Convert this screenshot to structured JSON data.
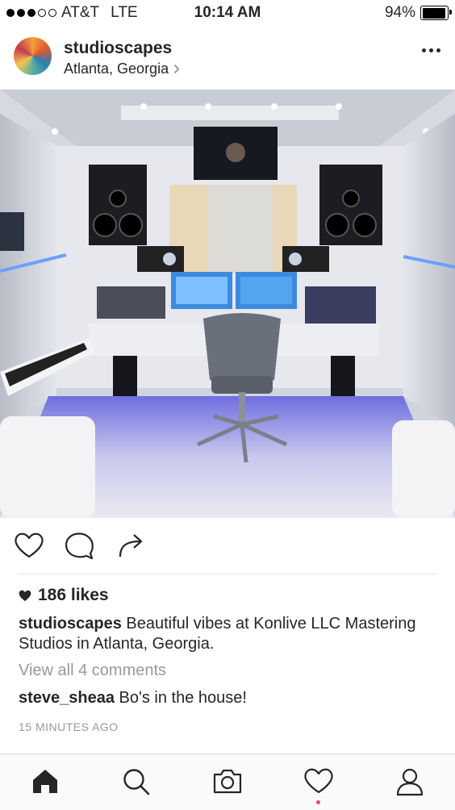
{
  "status_bar": {
    "carrier": "AT&T",
    "network": "LTE",
    "time": "10:14 AM",
    "battery": "94%",
    "battery_level": 0.94,
    "signal_bars": 3
  },
  "post": {
    "username": "studioscapes",
    "location": "Atlanta, Georgia",
    "likes": "186 likes",
    "caption_user": "studioscapes",
    "caption_text": "Beautiful vibes at Konlive LLC Mastering Studios in Atlanta, Georgia.",
    "view_comments": "View all 4 comments",
    "comment_user": "steve_sheaa",
    "comment_text": "Bo's in the house!",
    "timestamp": "15 MINUTES AGO"
  },
  "icons": {
    "like": "heart-icon",
    "comment": "comment-bubble-icon",
    "share": "share-arrow-icon",
    "home": "home-icon",
    "search": "search-icon",
    "camera": "camera-icon",
    "activity": "heart-icon",
    "profile": "profile-icon",
    "more": "more-dots-icon"
  },
  "colors": {
    "accent_notification": "#ed4956",
    "text": "#262626",
    "muted": "#999999"
  }
}
